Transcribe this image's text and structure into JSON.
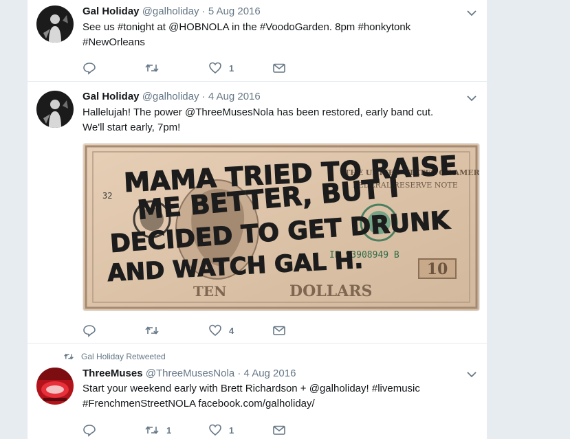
{
  "tweets": [
    {
      "name": "Gal Holiday",
      "handle": "@galholiday",
      "separator": "·",
      "date": "5 Aug 2016",
      "text_line1": "See us #tonight at @HOBNOLA in the #VoodoGarden. 8pm #honkytonk",
      "text_line2": "#NewOrleans",
      "reply_count": "",
      "retweet_count": "",
      "like_count": "1"
    },
    {
      "name": "Gal Holiday",
      "handle": "@galholiday",
      "separator": "·",
      "date": "4 Aug 2016",
      "text_line1": "Hallelujah! The power @ThreeMusesNola has been restored, early band cut.",
      "text_line2": "We'll start early, 7pm!",
      "reply_count": "",
      "retweet_count": "",
      "like_count": "4",
      "media": {
        "serial": "IB 93908949 B",
        "bill_ten": "TEN",
        "bill_dollars": "DOLLARS",
        "bill_frn": "FEDERAL RESERVE NOTE",
        "bill_usa": "THE UNITED STATES OF AMERICA",
        "bill_corner": "10",
        "bill_left_code": "32",
        "scrawl_line1": "MAMA TRIED TO RAISE",
        "scrawl_line2": "ME BETTER, BUT I",
        "scrawl_line3": "DECIDED TO GET DRUNK",
        "scrawl_line4": "AND WATCH GAL H."
      }
    },
    {
      "context": "Gal Holiday Retweeted",
      "name": "ThreeMuses",
      "handle": "@ThreeMusesNola",
      "separator": "·",
      "date": "4 Aug 2016",
      "text_line1": "Start your weekend early with Brett Richardson + @galholiday! #livemusic",
      "text_line2": "#FrenchmenStreetNOLA facebook.com/galholiday/",
      "reply_count": "",
      "retweet_count": "1",
      "like_count": "1"
    }
  ],
  "colors": {
    "background": "#e6ecf0",
    "card": "#ffffff",
    "secondary_text": "#657786",
    "primary_text": "#14171a"
  },
  "icons": [
    "reply-icon",
    "retweet-icon",
    "heart-icon",
    "direct-message-icon",
    "chevron-down-icon",
    "retweeted-icon"
  ]
}
